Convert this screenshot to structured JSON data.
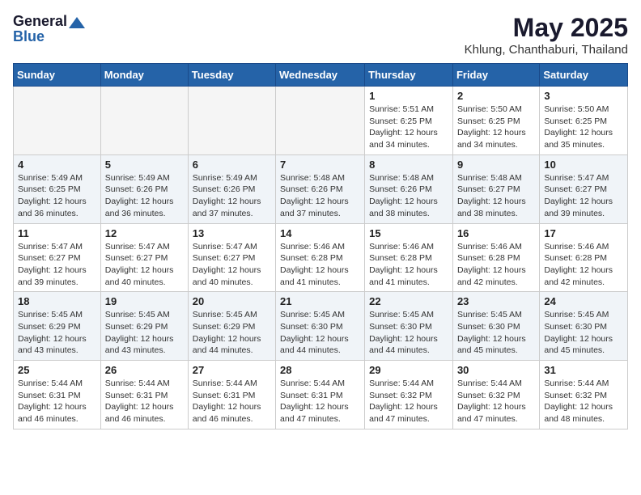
{
  "logo": {
    "general": "General",
    "blue": "Blue"
  },
  "title": "May 2025",
  "location": "Khlung, Chanthaburi, Thailand",
  "headers": [
    "Sunday",
    "Monday",
    "Tuesday",
    "Wednesday",
    "Thursday",
    "Friday",
    "Saturday"
  ],
  "weeks": [
    [
      {
        "day": "",
        "info": ""
      },
      {
        "day": "",
        "info": ""
      },
      {
        "day": "",
        "info": ""
      },
      {
        "day": "",
        "info": ""
      },
      {
        "day": "1",
        "info": "Sunrise: 5:51 AM\nSunset: 6:25 PM\nDaylight: 12 hours\nand 34 minutes."
      },
      {
        "day": "2",
        "info": "Sunrise: 5:50 AM\nSunset: 6:25 PM\nDaylight: 12 hours\nand 34 minutes."
      },
      {
        "day": "3",
        "info": "Sunrise: 5:50 AM\nSunset: 6:25 PM\nDaylight: 12 hours\nand 35 minutes."
      }
    ],
    [
      {
        "day": "4",
        "info": "Sunrise: 5:49 AM\nSunset: 6:25 PM\nDaylight: 12 hours\nand 36 minutes."
      },
      {
        "day": "5",
        "info": "Sunrise: 5:49 AM\nSunset: 6:26 PM\nDaylight: 12 hours\nand 36 minutes."
      },
      {
        "day": "6",
        "info": "Sunrise: 5:49 AM\nSunset: 6:26 PM\nDaylight: 12 hours\nand 37 minutes."
      },
      {
        "day": "7",
        "info": "Sunrise: 5:48 AM\nSunset: 6:26 PM\nDaylight: 12 hours\nand 37 minutes."
      },
      {
        "day": "8",
        "info": "Sunrise: 5:48 AM\nSunset: 6:26 PM\nDaylight: 12 hours\nand 38 minutes."
      },
      {
        "day": "9",
        "info": "Sunrise: 5:48 AM\nSunset: 6:27 PM\nDaylight: 12 hours\nand 38 minutes."
      },
      {
        "day": "10",
        "info": "Sunrise: 5:47 AM\nSunset: 6:27 PM\nDaylight: 12 hours\nand 39 minutes."
      }
    ],
    [
      {
        "day": "11",
        "info": "Sunrise: 5:47 AM\nSunset: 6:27 PM\nDaylight: 12 hours\nand 39 minutes."
      },
      {
        "day": "12",
        "info": "Sunrise: 5:47 AM\nSunset: 6:27 PM\nDaylight: 12 hours\nand 40 minutes."
      },
      {
        "day": "13",
        "info": "Sunrise: 5:47 AM\nSunset: 6:27 PM\nDaylight: 12 hours\nand 40 minutes."
      },
      {
        "day": "14",
        "info": "Sunrise: 5:46 AM\nSunset: 6:28 PM\nDaylight: 12 hours\nand 41 minutes."
      },
      {
        "day": "15",
        "info": "Sunrise: 5:46 AM\nSunset: 6:28 PM\nDaylight: 12 hours\nand 41 minutes."
      },
      {
        "day": "16",
        "info": "Sunrise: 5:46 AM\nSunset: 6:28 PM\nDaylight: 12 hours\nand 42 minutes."
      },
      {
        "day": "17",
        "info": "Sunrise: 5:46 AM\nSunset: 6:28 PM\nDaylight: 12 hours\nand 42 minutes."
      }
    ],
    [
      {
        "day": "18",
        "info": "Sunrise: 5:45 AM\nSunset: 6:29 PM\nDaylight: 12 hours\nand 43 minutes."
      },
      {
        "day": "19",
        "info": "Sunrise: 5:45 AM\nSunset: 6:29 PM\nDaylight: 12 hours\nand 43 minutes."
      },
      {
        "day": "20",
        "info": "Sunrise: 5:45 AM\nSunset: 6:29 PM\nDaylight: 12 hours\nand 44 minutes."
      },
      {
        "day": "21",
        "info": "Sunrise: 5:45 AM\nSunset: 6:30 PM\nDaylight: 12 hours\nand 44 minutes."
      },
      {
        "day": "22",
        "info": "Sunrise: 5:45 AM\nSunset: 6:30 PM\nDaylight: 12 hours\nand 44 minutes."
      },
      {
        "day": "23",
        "info": "Sunrise: 5:45 AM\nSunset: 6:30 PM\nDaylight: 12 hours\nand 45 minutes."
      },
      {
        "day": "24",
        "info": "Sunrise: 5:45 AM\nSunset: 6:30 PM\nDaylight: 12 hours\nand 45 minutes."
      }
    ],
    [
      {
        "day": "25",
        "info": "Sunrise: 5:44 AM\nSunset: 6:31 PM\nDaylight: 12 hours\nand 46 minutes."
      },
      {
        "day": "26",
        "info": "Sunrise: 5:44 AM\nSunset: 6:31 PM\nDaylight: 12 hours\nand 46 minutes."
      },
      {
        "day": "27",
        "info": "Sunrise: 5:44 AM\nSunset: 6:31 PM\nDaylight: 12 hours\nand 46 minutes."
      },
      {
        "day": "28",
        "info": "Sunrise: 5:44 AM\nSunset: 6:31 PM\nDaylight: 12 hours\nand 47 minutes."
      },
      {
        "day": "29",
        "info": "Sunrise: 5:44 AM\nSunset: 6:32 PM\nDaylight: 12 hours\nand 47 minutes."
      },
      {
        "day": "30",
        "info": "Sunrise: 5:44 AM\nSunset: 6:32 PM\nDaylight: 12 hours\nand 47 minutes."
      },
      {
        "day": "31",
        "info": "Sunrise: 5:44 AM\nSunset: 6:32 PM\nDaylight: 12 hours\nand 48 minutes."
      }
    ]
  ]
}
